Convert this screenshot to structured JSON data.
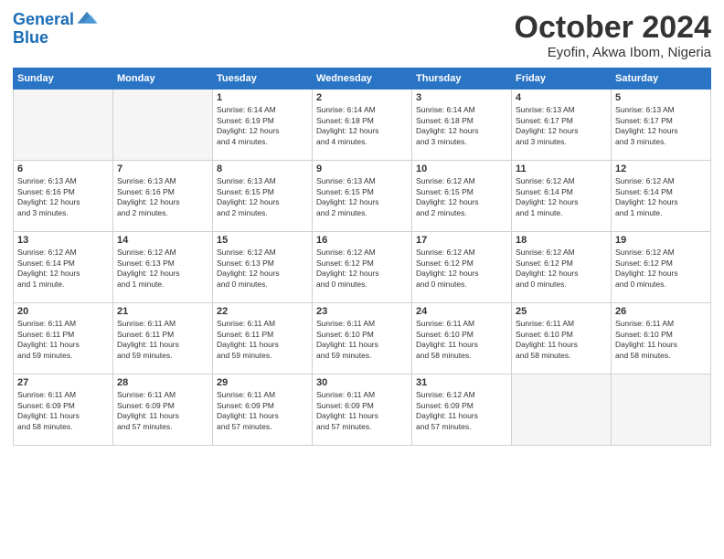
{
  "logo": {
    "line1": "General",
    "line2": "Blue"
  },
  "header": {
    "month": "October 2024",
    "location": "Eyofin, Akwa Ibom, Nigeria"
  },
  "days_of_week": [
    "Sunday",
    "Monday",
    "Tuesday",
    "Wednesday",
    "Thursday",
    "Friday",
    "Saturday"
  ],
  "weeks": [
    [
      {
        "day": "",
        "empty": true
      },
      {
        "day": "",
        "empty": true
      },
      {
        "day": "1",
        "line1": "Sunrise: 6:14 AM",
        "line2": "Sunset: 6:19 PM",
        "line3": "Daylight: 12 hours",
        "line4": "and 4 minutes."
      },
      {
        "day": "2",
        "line1": "Sunrise: 6:14 AM",
        "line2": "Sunset: 6:18 PM",
        "line3": "Daylight: 12 hours",
        "line4": "and 4 minutes."
      },
      {
        "day": "3",
        "line1": "Sunrise: 6:14 AM",
        "line2": "Sunset: 6:18 PM",
        "line3": "Daylight: 12 hours",
        "line4": "and 3 minutes."
      },
      {
        "day": "4",
        "line1": "Sunrise: 6:13 AM",
        "line2": "Sunset: 6:17 PM",
        "line3": "Daylight: 12 hours",
        "line4": "and 3 minutes."
      },
      {
        "day": "5",
        "line1": "Sunrise: 6:13 AM",
        "line2": "Sunset: 6:17 PM",
        "line3": "Daylight: 12 hours",
        "line4": "and 3 minutes."
      }
    ],
    [
      {
        "day": "6",
        "line1": "Sunrise: 6:13 AM",
        "line2": "Sunset: 6:16 PM",
        "line3": "Daylight: 12 hours",
        "line4": "and 3 minutes."
      },
      {
        "day": "7",
        "line1": "Sunrise: 6:13 AM",
        "line2": "Sunset: 6:16 PM",
        "line3": "Daylight: 12 hours",
        "line4": "and 2 minutes."
      },
      {
        "day": "8",
        "line1": "Sunrise: 6:13 AM",
        "line2": "Sunset: 6:15 PM",
        "line3": "Daylight: 12 hours",
        "line4": "and 2 minutes."
      },
      {
        "day": "9",
        "line1": "Sunrise: 6:13 AM",
        "line2": "Sunset: 6:15 PM",
        "line3": "Daylight: 12 hours",
        "line4": "and 2 minutes."
      },
      {
        "day": "10",
        "line1": "Sunrise: 6:12 AM",
        "line2": "Sunset: 6:15 PM",
        "line3": "Daylight: 12 hours",
        "line4": "and 2 minutes."
      },
      {
        "day": "11",
        "line1": "Sunrise: 6:12 AM",
        "line2": "Sunset: 6:14 PM",
        "line3": "Daylight: 12 hours",
        "line4": "and 1 minute."
      },
      {
        "day": "12",
        "line1": "Sunrise: 6:12 AM",
        "line2": "Sunset: 6:14 PM",
        "line3": "Daylight: 12 hours",
        "line4": "and 1 minute."
      }
    ],
    [
      {
        "day": "13",
        "line1": "Sunrise: 6:12 AM",
        "line2": "Sunset: 6:14 PM",
        "line3": "Daylight: 12 hours",
        "line4": "and 1 minute."
      },
      {
        "day": "14",
        "line1": "Sunrise: 6:12 AM",
        "line2": "Sunset: 6:13 PM",
        "line3": "Daylight: 12 hours",
        "line4": "and 1 minute."
      },
      {
        "day": "15",
        "line1": "Sunrise: 6:12 AM",
        "line2": "Sunset: 6:13 PM",
        "line3": "Daylight: 12 hours",
        "line4": "and 0 minutes."
      },
      {
        "day": "16",
        "line1": "Sunrise: 6:12 AM",
        "line2": "Sunset: 6:12 PM",
        "line3": "Daylight: 12 hours",
        "line4": "and 0 minutes."
      },
      {
        "day": "17",
        "line1": "Sunrise: 6:12 AM",
        "line2": "Sunset: 6:12 PM",
        "line3": "Daylight: 12 hours",
        "line4": "and 0 minutes."
      },
      {
        "day": "18",
        "line1": "Sunrise: 6:12 AM",
        "line2": "Sunset: 6:12 PM",
        "line3": "Daylight: 12 hours",
        "line4": "and 0 minutes."
      },
      {
        "day": "19",
        "line1": "Sunrise: 6:12 AM",
        "line2": "Sunset: 6:12 PM",
        "line3": "Daylight: 12 hours",
        "line4": "and 0 minutes."
      }
    ],
    [
      {
        "day": "20",
        "line1": "Sunrise: 6:11 AM",
        "line2": "Sunset: 6:11 PM",
        "line3": "Daylight: 11 hours",
        "line4": "and 59 minutes."
      },
      {
        "day": "21",
        "line1": "Sunrise: 6:11 AM",
        "line2": "Sunset: 6:11 PM",
        "line3": "Daylight: 11 hours",
        "line4": "and 59 minutes."
      },
      {
        "day": "22",
        "line1": "Sunrise: 6:11 AM",
        "line2": "Sunset: 6:11 PM",
        "line3": "Daylight: 11 hours",
        "line4": "and 59 minutes."
      },
      {
        "day": "23",
        "line1": "Sunrise: 6:11 AM",
        "line2": "Sunset: 6:10 PM",
        "line3": "Daylight: 11 hours",
        "line4": "and 59 minutes."
      },
      {
        "day": "24",
        "line1": "Sunrise: 6:11 AM",
        "line2": "Sunset: 6:10 PM",
        "line3": "Daylight: 11 hours",
        "line4": "and 58 minutes."
      },
      {
        "day": "25",
        "line1": "Sunrise: 6:11 AM",
        "line2": "Sunset: 6:10 PM",
        "line3": "Daylight: 11 hours",
        "line4": "and 58 minutes."
      },
      {
        "day": "26",
        "line1": "Sunrise: 6:11 AM",
        "line2": "Sunset: 6:10 PM",
        "line3": "Daylight: 11 hours",
        "line4": "and 58 minutes."
      }
    ],
    [
      {
        "day": "27",
        "line1": "Sunrise: 6:11 AM",
        "line2": "Sunset: 6:09 PM",
        "line3": "Daylight: 11 hours",
        "line4": "and 58 minutes."
      },
      {
        "day": "28",
        "line1": "Sunrise: 6:11 AM",
        "line2": "Sunset: 6:09 PM",
        "line3": "Daylight: 11 hours",
        "line4": "and 57 minutes."
      },
      {
        "day": "29",
        "line1": "Sunrise: 6:11 AM",
        "line2": "Sunset: 6:09 PM",
        "line3": "Daylight: 11 hours",
        "line4": "and 57 minutes."
      },
      {
        "day": "30",
        "line1": "Sunrise: 6:11 AM",
        "line2": "Sunset: 6:09 PM",
        "line3": "Daylight: 11 hours",
        "line4": "and 57 minutes."
      },
      {
        "day": "31",
        "line1": "Sunrise: 6:12 AM",
        "line2": "Sunset: 6:09 PM",
        "line3": "Daylight: 11 hours",
        "line4": "and 57 minutes."
      },
      {
        "day": "",
        "empty": true
      },
      {
        "day": "",
        "empty": true
      }
    ]
  ]
}
